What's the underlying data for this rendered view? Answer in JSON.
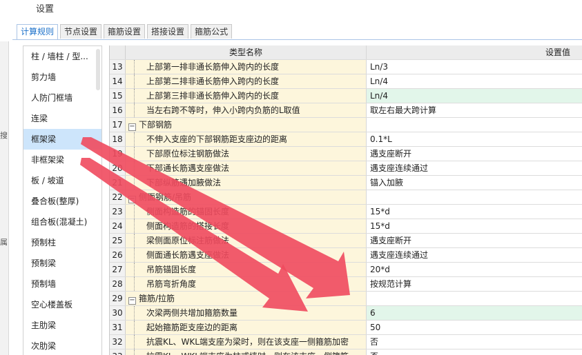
{
  "window": {
    "title": "设置"
  },
  "tabs": [
    {
      "label": "计算规则",
      "active": true
    },
    {
      "label": "节点设置",
      "active": false
    },
    {
      "label": "箍筋设置",
      "active": false
    },
    {
      "label": "搭接设置",
      "active": false
    },
    {
      "label": "箍筋公式",
      "active": false
    }
  ],
  "left_edge": {
    "chars": [
      "搜",
      "属"
    ]
  },
  "sidebar": {
    "items": [
      {
        "label": "柱 / 墙柱 / 型..."
      },
      {
        "label": "剪力墙"
      },
      {
        "label": "人防门框墙"
      },
      {
        "label": "连梁"
      },
      {
        "label": "框架梁",
        "selected": true
      },
      {
        "label": "非框架梁"
      },
      {
        "label": "板 / 坡道"
      },
      {
        "label": "叠合板(整厚)"
      },
      {
        "label": "组合板(混凝土)"
      },
      {
        "label": "预制柱"
      },
      {
        "label": "预制梁"
      },
      {
        "label": "预制墙"
      },
      {
        "label": "空心楼盖板"
      },
      {
        "label": "主肋梁"
      },
      {
        "label": "次肋梁"
      }
    ]
  },
  "table": {
    "headers": {
      "num": "",
      "name": "类型名称",
      "value": "设置值"
    },
    "rows": [
      {
        "num": "13",
        "name": "上部第一排非通长筋伸入跨内的长度",
        "value": "Ln/3",
        "type": "child"
      },
      {
        "num": "14",
        "name": "上部第二排非通长筋伸入跨内的长度",
        "value": "Ln/4",
        "type": "child"
      },
      {
        "num": "15",
        "name": "上部第三排非通长筋伸入跨内的长度",
        "value": "Ln/4",
        "type": "child",
        "highlight": true
      },
      {
        "num": "16",
        "name": "当左右跨不等时，伸入小跨内负筋的L取值",
        "value": "取左右最大跨计算",
        "type": "child"
      },
      {
        "num": "17",
        "name": "下部钢筋",
        "value": "",
        "type": "group",
        "toggle": "−"
      },
      {
        "num": "18",
        "name": "不伸入支座的下部钢筋距支座边的距离",
        "value": "0.1*L",
        "type": "child"
      },
      {
        "num": "19",
        "name": "下部原位标注钢筋做法",
        "value": "遇支座断开",
        "type": "child"
      },
      {
        "num": "20",
        "name": "下部通长筋遇支座做法",
        "value": "遇支座连续通过",
        "type": "child"
      },
      {
        "num": "21",
        "name": "下部纵筋遇加腋做法",
        "value": "锚入加腋",
        "type": "child"
      },
      {
        "num": "22",
        "name": "侧面钢筋/吊筋",
        "value": "",
        "type": "group",
        "toggle": "−"
      },
      {
        "num": "23",
        "name": "侧面构造筋的锚固长度",
        "value": "15*d",
        "type": "child"
      },
      {
        "num": "24",
        "name": "侧面构造筋的搭接长度",
        "value": "15*d",
        "type": "child"
      },
      {
        "num": "25",
        "name": "梁侧面原位标注筋做法",
        "value": "遇支座断开",
        "type": "child"
      },
      {
        "num": "26",
        "name": "侧面通长筋遇支座做法",
        "value": "遇支座连续通过",
        "type": "child"
      },
      {
        "num": "27",
        "name": "吊筋锚固长度",
        "value": "20*d",
        "type": "child"
      },
      {
        "num": "28",
        "name": "吊筋弯折角度",
        "value": "按规范计算",
        "type": "child"
      },
      {
        "num": "29",
        "name": "箍筋/拉筋",
        "value": "",
        "type": "group",
        "toggle": "−"
      },
      {
        "num": "30",
        "name": "次梁两侧共增加箍筋数量",
        "value": "6",
        "type": "child",
        "highlight": true
      },
      {
        "num": "31",
        "name": "起始箍筋距支座边的距离",
        "value": "50",
        "type": "child"
      },
      {
        "num": "32",
        "name": "抗震KL、WKL端支座为梁时，则在该支座一侧箍筋加密",
        "value": "否",
        "type": "child"
      },
      {
        "num": "33",
        "name": "抗震KL、WKL端支座为柱或墙时，则在该支座一侧箍筋",
        "value": "否",
        "type": "child"
      }
    ]
  },
  "annotation": {
    "arrow_color": "#f04a5e"
  }
}
